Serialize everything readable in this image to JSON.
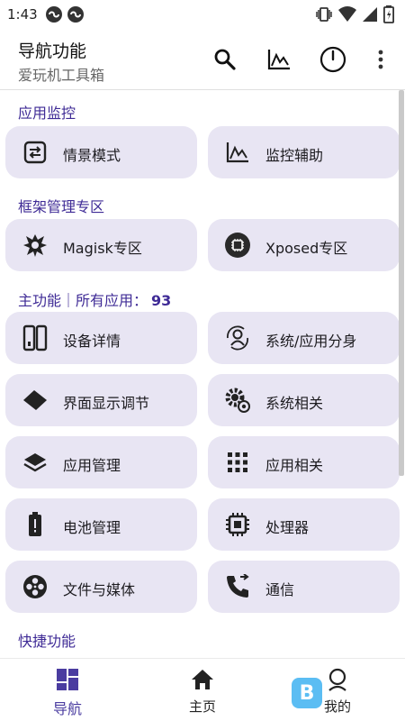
{
  "status_bar": {
    "time": "1:43"
  },
  "app_bar": {
    "title": "导航功能",
    "subtitle": "爱玩机工具箱"
  },
  "sections": {
    "monitor": {
      "title": "应用监控"
    },
    "framework": {
      "title": "框架管理专区"
    },
    "main": {
      "title": "主功能｜所有应用：",
      "count": "93"
    },
    "quick": {
      "title": "快捷功能"
    }
  },
  "tiles": {
    "scene_mode": "情景模式",
    "monitor_assist": "监控辅助",
    "magisk": "Magisk专区",
    "xposed": "Xposed专区",
    "device_info": "设备详情",
    "system_clone": "系统/应用分身",
    "display_adjust": "界面显示调节",
    "system_related": "系统相关",
    "app_manage": "应用管理",
    "app_related": "应用相关",
    "battery_manage": "电池管理",
    "processor": "处理器",
    "file_media": "文件与媒体",
    "communication": "通信"
  },
  "bottom_nav": [
    {
      "label": "导航",
      "icon": "dashboard-icon",
      "active": true
    },
    {
      "label": "主页",
      "icon": "home-icon",
      "active": false
    },
    {
      "label": "我的",
      "icon": "profile-icon",
      "active": false
    }
  ],
  "watermark": {
    "logo_text": "B"
  },
  "colors": {
    "accent": "#4a3ca0",
    "tile_bg": "#e8e5f3",
    "section_title": "#3f2b96"
  }
}
